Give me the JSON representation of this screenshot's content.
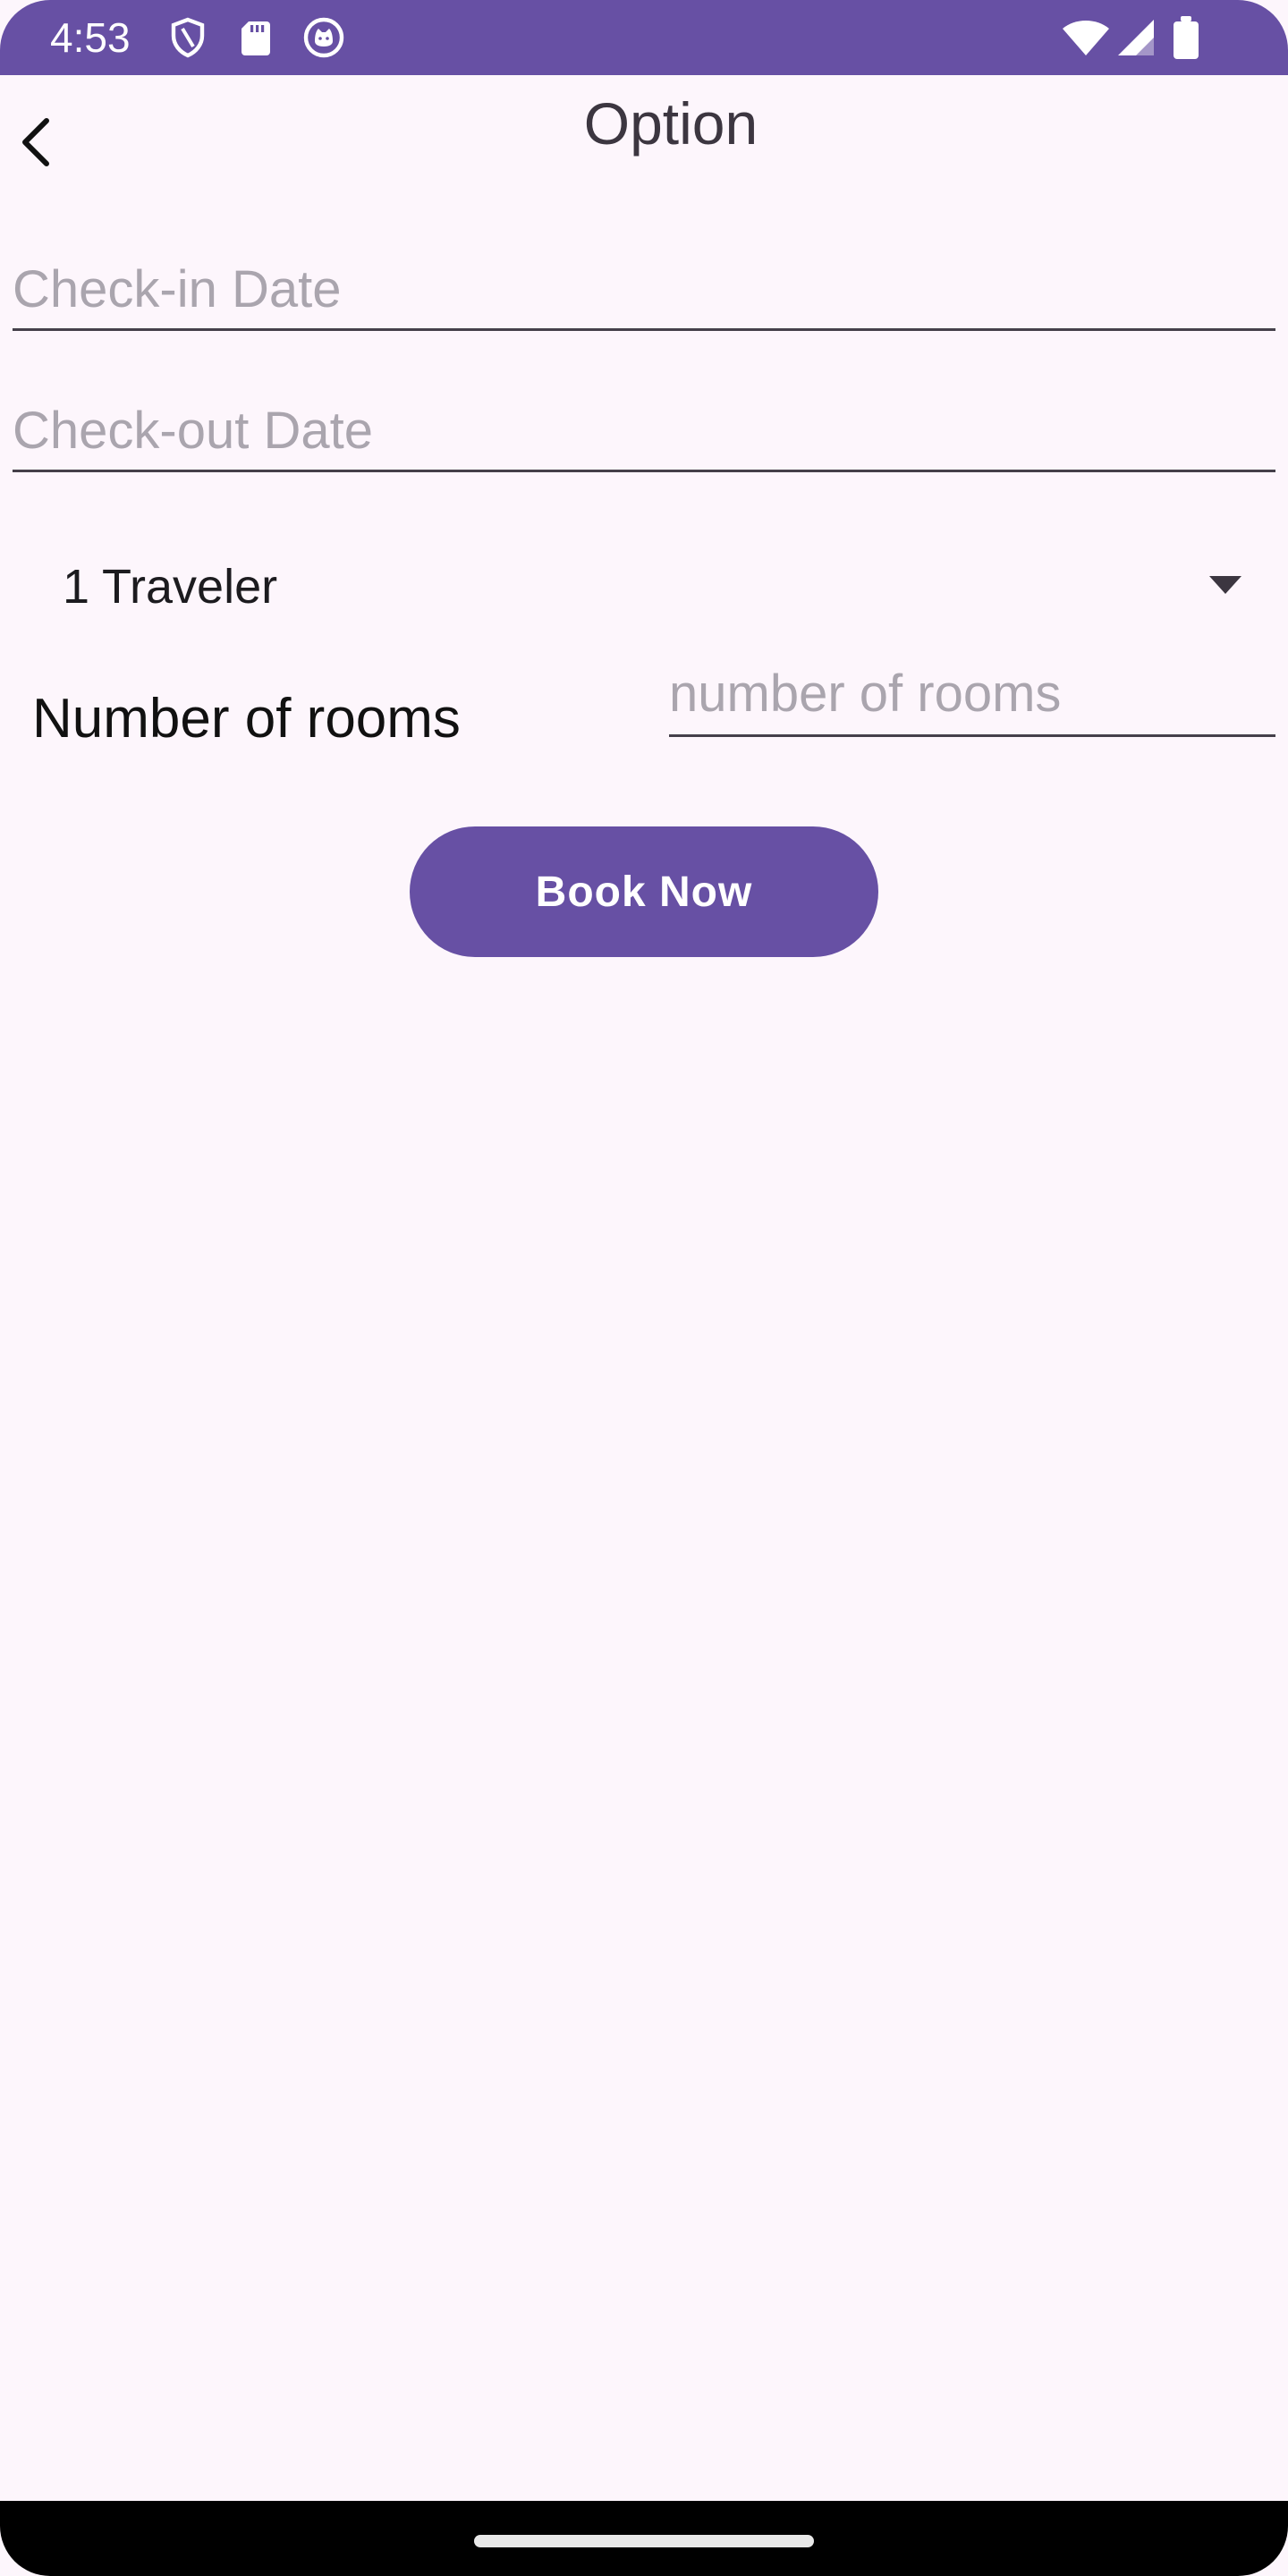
{
  "status_bar": {
    "time": "4:53",
    "icons_left": [
      "shield-icon",
      "sd-card-icon",
      "cat-face-icon"
    ],
    "icons_right": [
      "wifi-icon",
      "cell-signal-icon",
      "battery-icon"
    ],
    "background_color": "#6750a4"
  },
  "app_bar": {
    "title": "Option",
    "back_icon": "chevron-left-icon"
  },
  "form": {
    "checkin_placeholder": "Check-in Date",
    "checkin_value": "",
    "checkout_placeholder": "Check-out Date",
    "checkout_value": "",
    "travelers_selected": "1 Traveler",
    "rooms_label": "Number of rooms",
    "rooms_placeholder": "number of rooms",
    "rooms_value": "",
    "book_button_label": "Book Now"
  },
  "colors": {
    "accent": "#6750a4",
    "background": "#fdf6fc",
    "placeholder": "#aaa5ae"
  }
}
